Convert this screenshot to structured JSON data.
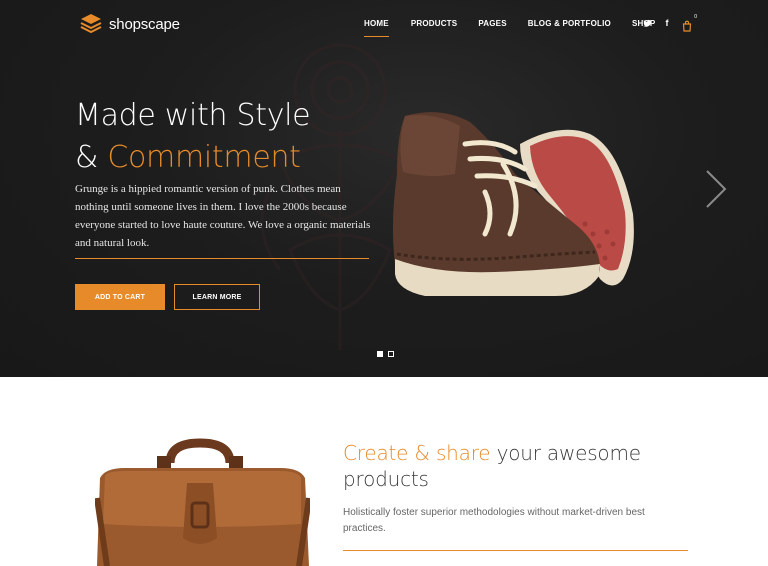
{
  "brand": {
    "name": "shopscape"
  },
  "nav": {
    "items": [
      {
        "label": "HOME",
        "active": true
      },
      {
        "label": "PRODUCTS",
        "active": false
      },
      {
        "label": "PAGES",
        "active": false
      },
      {
        "label": "BLOG & PORTFOLIO",
        "active": false
      },
      {
        "label": "SHOP",
        "active": false
      }
    ]
  },
  "social": {
    "twitter_icon": "twitter-icon",
    "facebook_icon": "facebook-icon",
    "cart_icon": "cart-icon",
    "cart_count": "0",
    "twitter_glyph": "🐦",
    "facebook_glyph": "f"
  },
  "hero": {
    "title_line1": "Made with Style",
    "title_amp": "& ",
    "title_accent": "Commitment",
    "text": "Grunge is a hippied romantic version of punk. Clothes mean nothing until someone lives in them. I love the 2000s because everyone started to love haute couture. We love a organic materials and natural look.",
    "add_to_cart": "ADD TO CART",
    "learn_more": "LEARN MORE",
    "slides": [
      {
        "active": true
      },
      {
        "active": false
      }
    ]
  },
  "feature": {
    "title_accent": "Create & share",
    "title_rest": " your awesome products",
    "text": "Holistically foster superior methodologies without market-driven best practices."
  },
  "colors": {
    "accent": "#e78b2a",
    "dark": "#1b1b1b",
    "text": "#3a3a3a"
  }
}
